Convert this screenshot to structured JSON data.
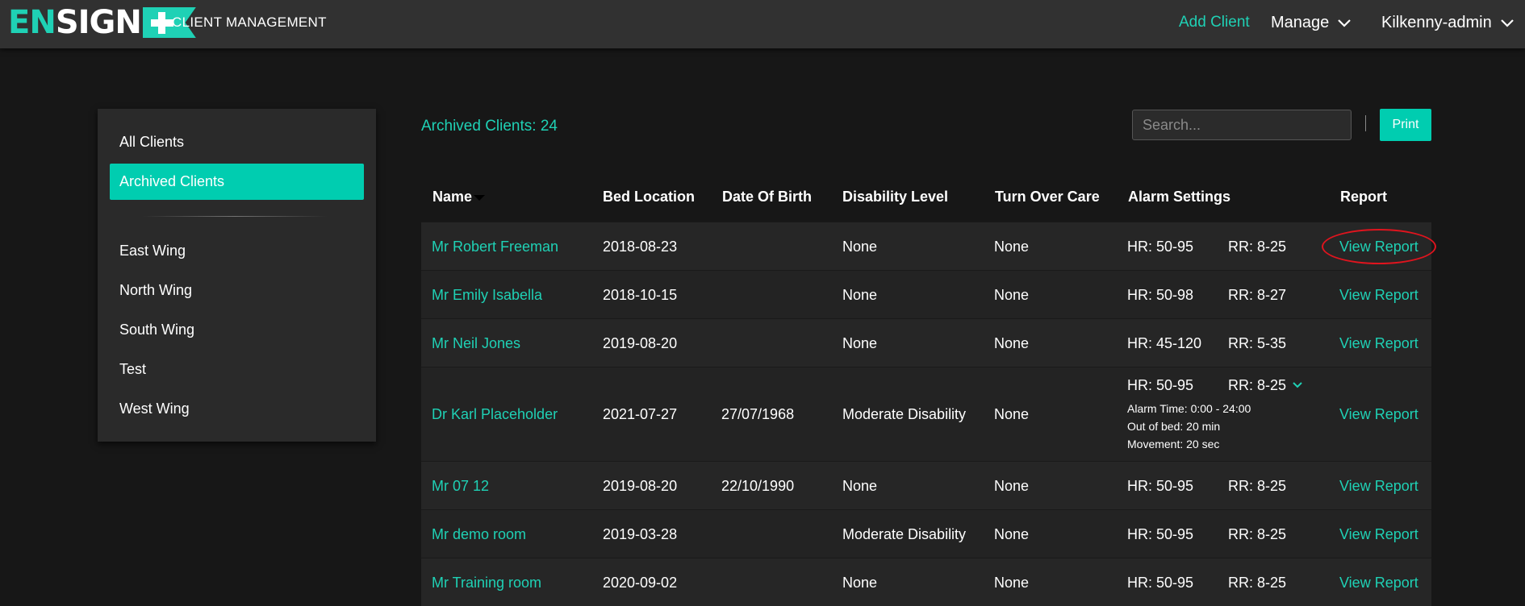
{
  "app": {
    "logo_en": "EN",
    "logo_sign": "SIGN",
    "title": "CLIENT MANAGEMENT"
  },
  "nav": {
    "add_client": "Add Client",
    "manage": "Manage",
    "user": "Kilkenny-admin"
  },
  "sidebar": {
    "items": [
      {
        "label": "All Clients"
      },
      {
        "label": "Archived Clients",
        "active": true
      },
      {
        "label": "East Wing"
      },
      {
        "label": "North Wing"
      },
      {
        "label": "South Wing"
      },
      {
        "label": "Test"
      },
      {
        "label": "West Wing"
      }
    ]
  },
  "main": {
    "archived_label": "Archived Clients: 24",
    "search_placeholder": "Search...",
    "print_label": "Print"
  },
  "table": {
    "columns": [
      "Name",
      "Bed Location",
      "Date Of Birth",
      "Disability Level",
      "Turn Over Care",
      "Alarm Settings",
      "Report"
    ],
    "rows": [
      {
        "name": "Mr Robert Freeman",
        "bed": "2018-08-23",
        "dob": "",
        "disability": "None",
        "care": "None",
        "hr": "HR: 50-95",
        "rr": "RR: 8-25",
        "report": "View Report"
      },
      {
        "name": "Mr Emily Isabella",
        "bed": "2018-10-15",
        "dob": "",
        "disability": "None",
        "care": "None",
        "hr": "HR: 50-98",
        "rr": "RR: 8-27",
        "report": "View Report"
      },
      {
        "name": "Mr Neil Jones",
        "bed": "2019-08-20",
        "dob": "",
        "disability": "None",
        "care": "None",
        "hr": "HR: 45-120",
        "rr": "RR: 5-35",
        "report": "View Report"
      },
      {
        "name": "Dr Karl Placeholder",
        "bed": "2021-07-27",
        "dob": "27/07/1968",
        "disability": "Moderate Disability",
        "care": "None",
        "hr": "HR: 50-95",
        "rr": "RR: 8-25",
        "report": "View Report",
        "alarm_time": "Alarm Time: 0:00 - 24:00",
        "out_of_bed": "Out of bed: 20 min",
        "movement": "Movement: 20 sec"
      },
      {
        "name": "Mr 07 12",
        "bed": "2019-08-20",
        "dob": "22/10/1990",
        "disability": "None",
        "care": "None",
        "hr": "HR: 50-95",
        "rr": "RR: 8-25",
        "report": "View Report"
      },
      {
        "name": "Mr demo room",
        "bed": "2019-03-28",
        "dob": "",
        "disability": "Moderate Disability",
        "care": "None",
        "hr": "HR: 50-95",
        "rr": "RR: 8-25",
        "report": "View Report"
      },
      {
        "name": "Mr Training room",
        "bed": "2020-09-02",
        "dob": "",
        "disability": "None",
        "care": "None",
        "hr": "HR: 50-95",
        "rr": "RR: 8-25",
        "report": "View Report"
      }
    ]
  },
  "colors": {
    "accent": "#1fd1b5",
    "highlight_ring": "#e0141e"
  }
}
